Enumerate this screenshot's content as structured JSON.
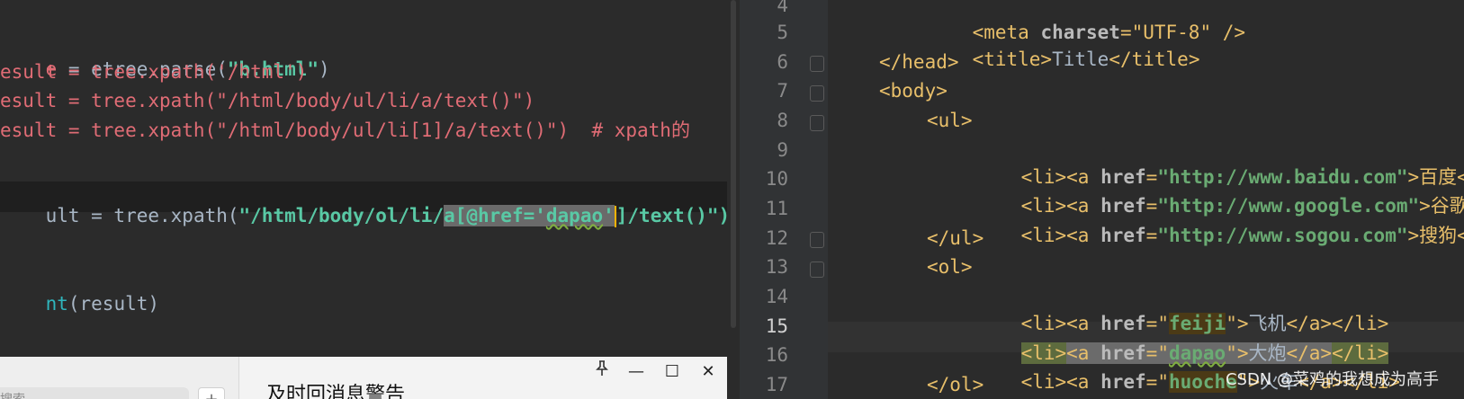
{
  "left_code": {
    "lines": [
      {
        "prefix": "e",
        "rest": " = etree.parse(",
        "str": "\"b.html\"",
        "tail": ")"
      },
      {
        "text": "esult = tree.xpath('/html')"
      },
      {
        "text": "esult = tree.xpath(\"/html/body/ul/li/a/text()\")"
      },
      {
        "text": "esult = tree.xpath(\"/html/body/ul/li[1]/a/text()\")",
        "comment": "  # xpath的"
      },
      {
        "p1": "ult = tree.xpath(",
        "p2": "\"/html/body/ol/li/",
        "sel1": "a[@href='",
        "sel2": "dapao",
        "sel3": "'",
        "p3": "]/text()\")"
      },
      {
        "p1": "nt",
        "p2": "(result)"
      }
    ]
  },
  "right_code": {
    "line_numbers": [
      "4",
      "5",
      "6",
      "7",
      "8",
      "9",
      "10",
      "11",
      "12",
      "13",
      "14",
      "15",
      "16",
      "17"
    ],
    "l4": {
      "a": "<meta ",
      "b": "charset",
      "c": "=\"UTF-8\" />"
    },
    "l5": {
      "a": "<title>",
      "b": "Title",
      "c": "</title>"
    },
    "l6": "</head>",
    "l7": "<body>",
    "l8": "<ul>",
    "l9": {
      "a": "<li><a ",
      "b": "href",
      "c": "=",
      "d": "\"http://www.baidu.com\"",
      "e": ">百度</"
    },
    "l10": {
      "a": "<li><a ",
      "b": "href",
      "c": "=",
      "d": "\"http://www.google.com\"",
      "e": ">谷歌<"
    },
    "l11": {
      "a": "<li><a ",
      "b": "href",
      "c": "=",
      "d": "\"http://www.sogou.com\"",
      "e": ">搜狗</"
    },
    "l12": "</ul>",
    "l13": "<ol>",
    "l14": {
      "a": "<li><a ",
      "b": "href",
      "c": "=\"",
      "d": "feiji",
      "e": "\">",
      "f": "飞机",
      "g": "</a></li>"
    },
    "l15": {
      "a": "<li>",
      "b": "<a ",
      "c": "href",
      "d": "=\"",
      "e": "dapao",
      "f": "\">",
      "g": "大炮",
      "h": "</a>",
      "i": "</li>"
    },
    "l16": {
      "a": "<li><a ",
      "b": "href",
      "c": "=\"",
      "d": "huoche",
      "e": "\">",
      "f": "火车",
      "g": "</a></li>"
    },
    "l17": "</ol>"
  },
  "popup": {
    "search_placeholder": "搜索",
    "add_label": "+",
    "title": "及时回消息警告",
    "pin_icon": "pin-icon",
    "min_label": "—",
    "max_label": "☐",
    "close_label": "✕"
  },
  "watermark": "CSDN @菜鸡的我想成为高手"
}
